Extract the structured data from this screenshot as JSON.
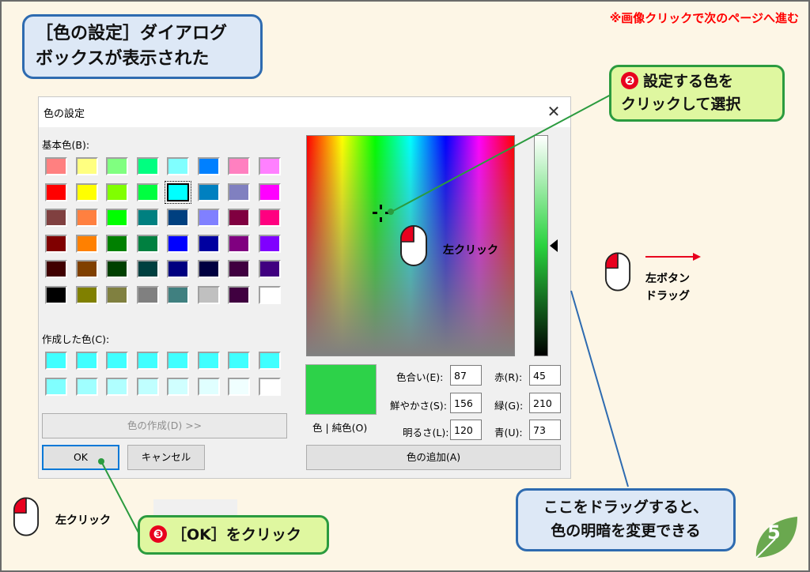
{
  "slide": {
    "title_callout": "［色の設定］ダイアログ\nボックスが表示された",
    "next_hint": "※画像クリックで次のページへ進む",
    "page_number": "5"
  },
  "dialog": {
    "title": "色の設定",
    "close_glyph": "✕",
    "basic_colors_label": "基本色(B):",
    "custom_colors_label": "作成した色(C):",
    "define_button": "色の作成(D) >>",
    "ok_button": "OK",
    "cancel_button": "キャンセル",
    "color_solid_label": "色 | 純色(O)",
    "add_button": "色の追加(A)",
    "fields": {
      "hue_label": "色合い(E):",
      "hue": "87",
      "sat_label": "鮮やかさ(S):",
      "sat": "156",
      "lum_label": "明るさ(L):",
      "lum": "120",
      "red_label": "赤(R):",
      "red": "45",
      "green_label": "緑(G):",
      "green": "210",
      "blue_label": "青(U):",
      "blue": "73"
    },
    "basic_colors": [
      [
        "#ff8080",
        "#ffff80",
        "#80ff80",
        "#00ff80",
        "#80ffff",
        "#0080ff",
        "#ff80c0",
        "#ff80ff"
      ],
      [
        "#ff0000",
        "#ffff00",
        "#80ff00",
        "#00ff40",
        "#00ffff",
        "#0080c0",
        "#8080c0",
        "#ff00ff"
      ],
      [
        "#804040",
        "#ff8040",
        "#00ff00",
        "#008080",
        "#004080",
        "#8080ff",
        "#800040",
        "#ff0080"
      ],
      [
        "#800000",
        "#ff8000",
        "#008000",
        "#008040",
        "#0000ff",
        "#0000a0",
        "#800080",
        "#8000ff"
      ],
      [
        "#400000",
        "#804000",
        "#004000",
        "#004040",
        "#000080",
        "#000040",
        "#400040",
        "#400080"
      ],
      [
        "#000000",
        "#808000",
        "#808040",
        "#808080",
        "#408080",
        "#c0c0c0",
        "#400040",
        "#ffffff"
      ]
    ],
    "custom_colors": [
      [
        "#40ffff",
        "#40ffff",
        "#40ffff",
        "#40ffff",
        "#40ffff",
        "#40ffff",
        "#40ffff",
        "#40ffff"
      ],
      [
        "#80ffff",
        "#a0ffff",
        "#b0ffff",
        "#c0ffff",
        "#d0ffff",
        "#e0ffff",
        "#f0ffff",
        "#ffffff"
      ]
    ],
    "current_color": "#2dd249"
  },
  "annotations": {
    "callout2_num": "❷",
    "callout2_text": "設定する色を",
    "callout2_text2": "クリックして選択",
    "callout3_num": "❸",
    "callout3_text": "［OK］をクリック",
    "callout_drag": "ここをドラッグすると、\n色の明暗を変更できる",
    "left_click": "左クリック",
    "left_click2": "左クリック",
    "left_drag1": "左ボタン",
    "left_drag2": "ドラッグ"
  },
  "colors": {
    "accent_red": "#ff0000",
    "callout_green_border": "#2b9b3f",
    "callout_blue_border": "#2e6bb0"
  }
}
